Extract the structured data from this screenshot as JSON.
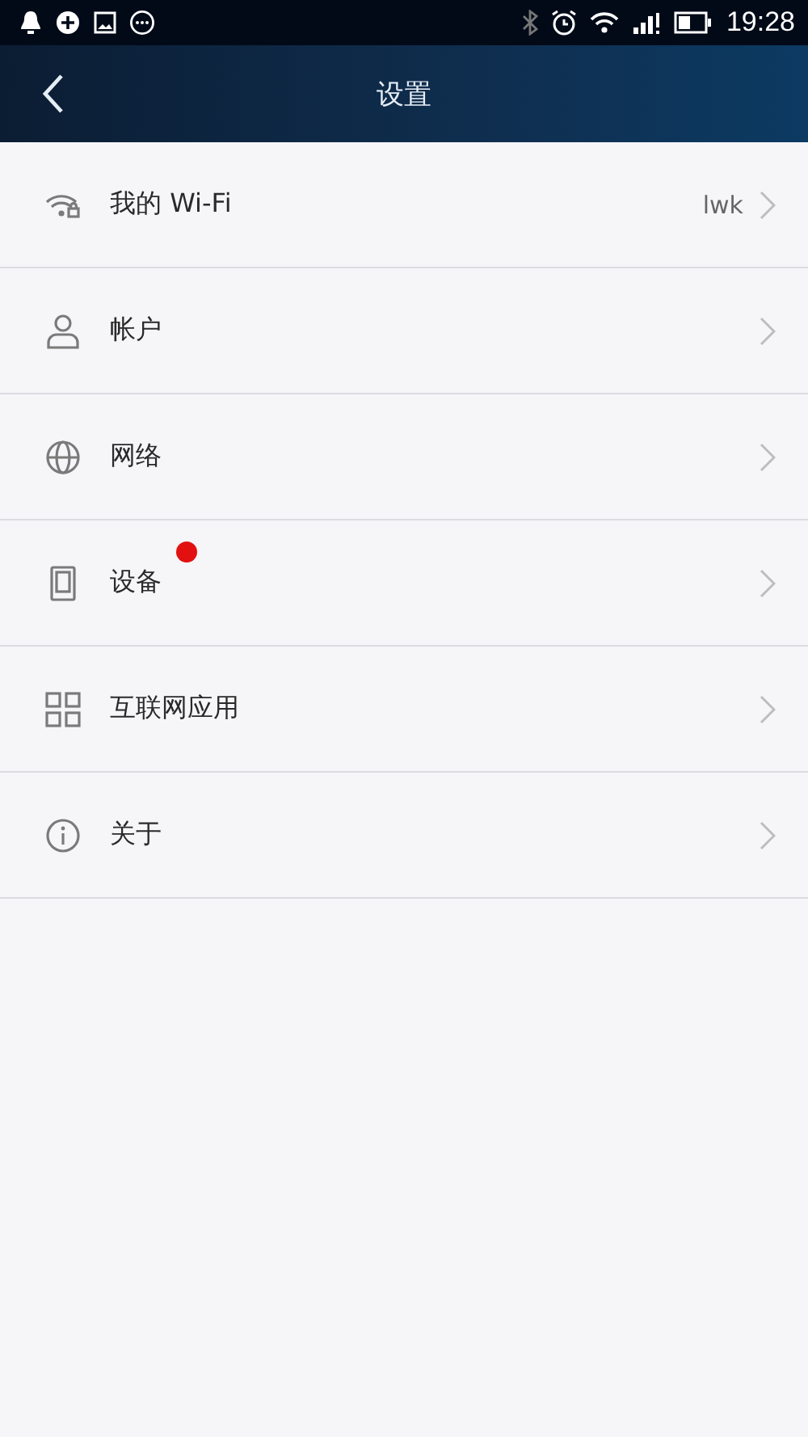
{
  "status_bar": {
    "time": "19:28"
  },
  "header": {
    "title": "设置"
  },
  "rows": [
    {
      "kind": "wifi",
      "label": "我的 Wi-Fi",
      "value": "lwk",
      "badge": false
    },
    {
      "kind": "account",
      "label": "帐户",
      "badge": false
    },
    {
      "kind": "network",
      "label": "网络",
      "badge": false
    },
    {
      "kind": "device",
      "label": "设备",
      "badge": true
    },
    {
      "kind": "apps",
      "label": "互联网应用",
      "badge": false
    },
    {
      "kind": "about",
      "label": "关于",
      "badge": false
    }
  ]
}
